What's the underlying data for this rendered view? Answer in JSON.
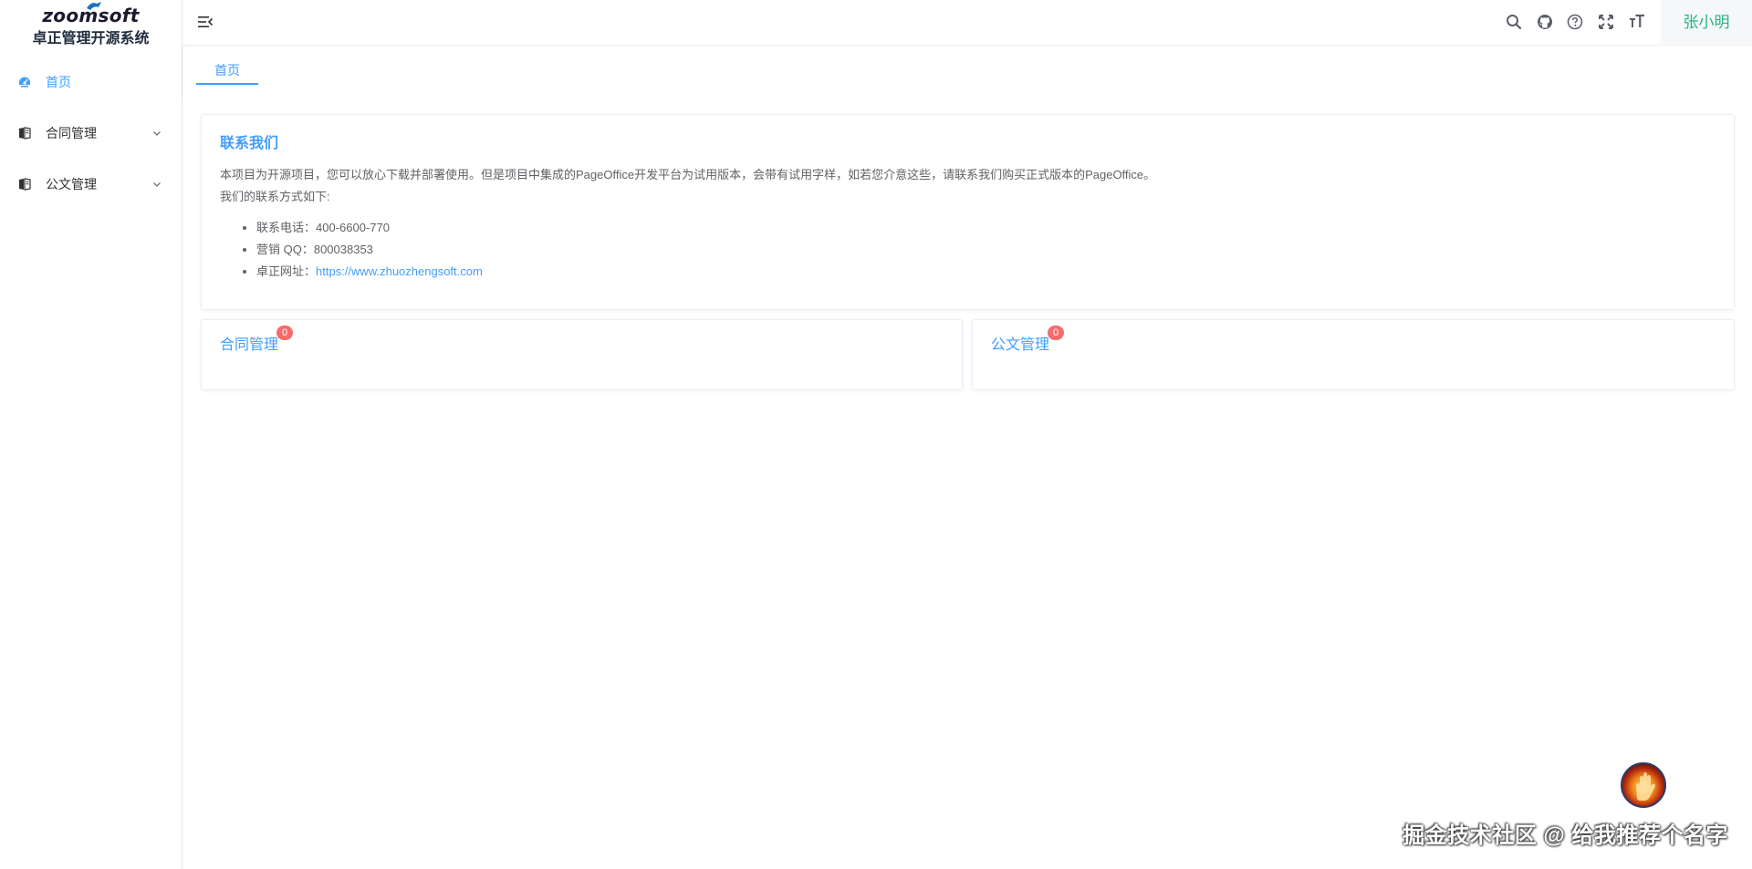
{
  "brand": {
    "logo_text": "zoomsoft",
    "system_name": "卓正管理开源系统"
  },
  "sidebar": {
    "items": [
      {
        "label": "首页",
        "icon": "dashboard-icon",
        "active": true
      },
      {
        "label": "合同管理",
        "icon": "book-icon",
        "expandable": true
      },
      {
        "label": "公文管理",
        "icon": "book-icon",
        "expandable": true
      }
    ]
  },
  "header": {
    "tools": [
      "hamburger-icon",
      "search-icon",
      "github-icon",
      "question-icon",
      "fullscreen-icon",
      "font-size-icon"
    ],
    "user_name": "张小明"
  },
  "tags": {
    "home_label": "首页"
  },
  "contact": {
    "title": "联系我们",
    "paragraph1": "本项目为开源项目，您可以放心下载并部署使用。但是项目中集成的PageOffice开发平台为试用版本，会带有试用字样，如若您介意这些，请联系我们购买正式版本的PageOffice。",
    "paragraph2": "我们的联系方式如下:",
    "phone_label": "联系电话：",
    "phone_value": "400-6600-770",
    "qq_label": "营销 QQ：",
    "qq_value": "800038353",
    "site_label": "卓正网址：",
    "site_value": "https://www.zhuozhengsoft.com"
  },
  "cards": [
    {
      "title": "合同管理",
      "badge": "0"
    },
    {
      "title": "公文管理",
      "badge": "0"
    }
  ],
  "watermark": "掘金技术社区 @ 给我推荐个名字",
  "colors": {
    "accent": "#409eff",
    "user": "#25b583",
    "badge": "#f56c6c"
  }
}
